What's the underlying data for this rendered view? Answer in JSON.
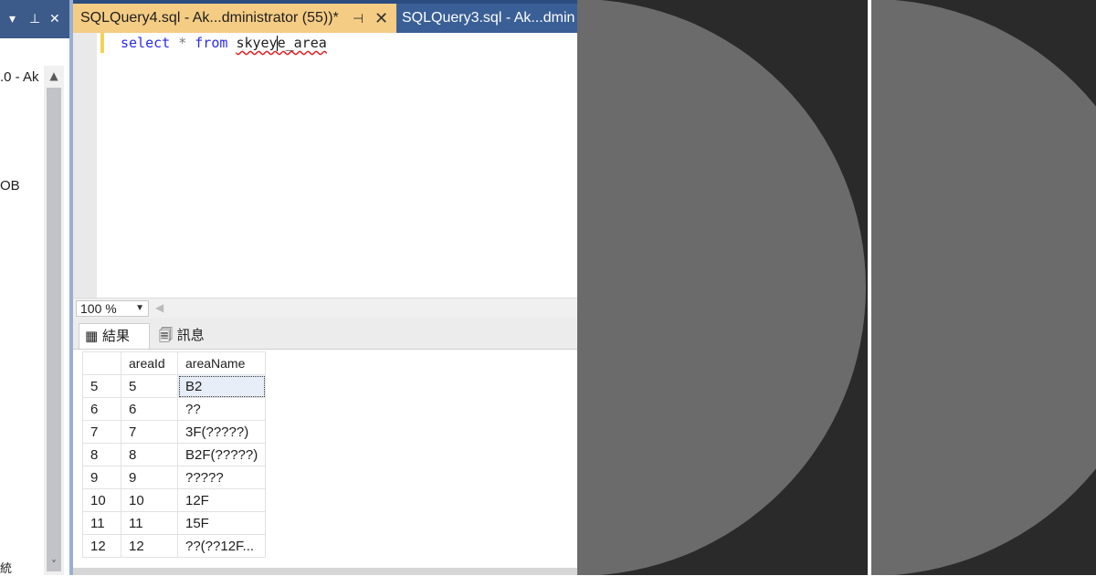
{
  "object_explorer": {
    "header_icons": [
      "chevron-down-icon",
      "pin-icon",
      "close-icon"
    ],
    "nodes": [
      ".0 - Ak",
      "OB"
    ],
    "bottom_node": "統"
  },
  "editor": {
    "active_tab": "SQLQuery4.sql - Ak...dministrator (55))*",
    "inactive_tab": "SQLQuery3.sql - Ak...dmin",
    "query": {
      "kw_select": "select",
      "star": "*",
      "kw_from": "from",
      "table_part1": "skyey",
      "table_part2": "e_area"
    },
    "zoom": "100 %"
  },
  "results": {
    "tabs": [
      "結果",
      "訊息"
    ],
    "columns": [
      "",
      "areaId",
      "areaName"
    ],
    "rows": [
      [
        "5",
        "5",
        "B2"
      ],
      [
        "6",
        "6",
        "??"
      ],
      [
        "7",
        "7",
        "3F(?????)"
      ],
      [
        "8",
        "8",
        "B2F(?????)"
      ],
      [
        "9",
        "9",
        "?????"
      ],
      [
        "10",
        "10",
        "12F"
      ],
      [
        "11",
        "11",
        "15F"
      ],
      [
        "12",
        "12",
        "??(??12F..."
      ]
    ]
  },
  "colors": {
    "tab_active": "#f5cc84",
    "tab_bar": "#2b4c7e",
    "keyword": "#2a2ae6",
    "deco_background": "#2a2a2a",
    "deco_circle": "#6b6b6b"
  }
}
